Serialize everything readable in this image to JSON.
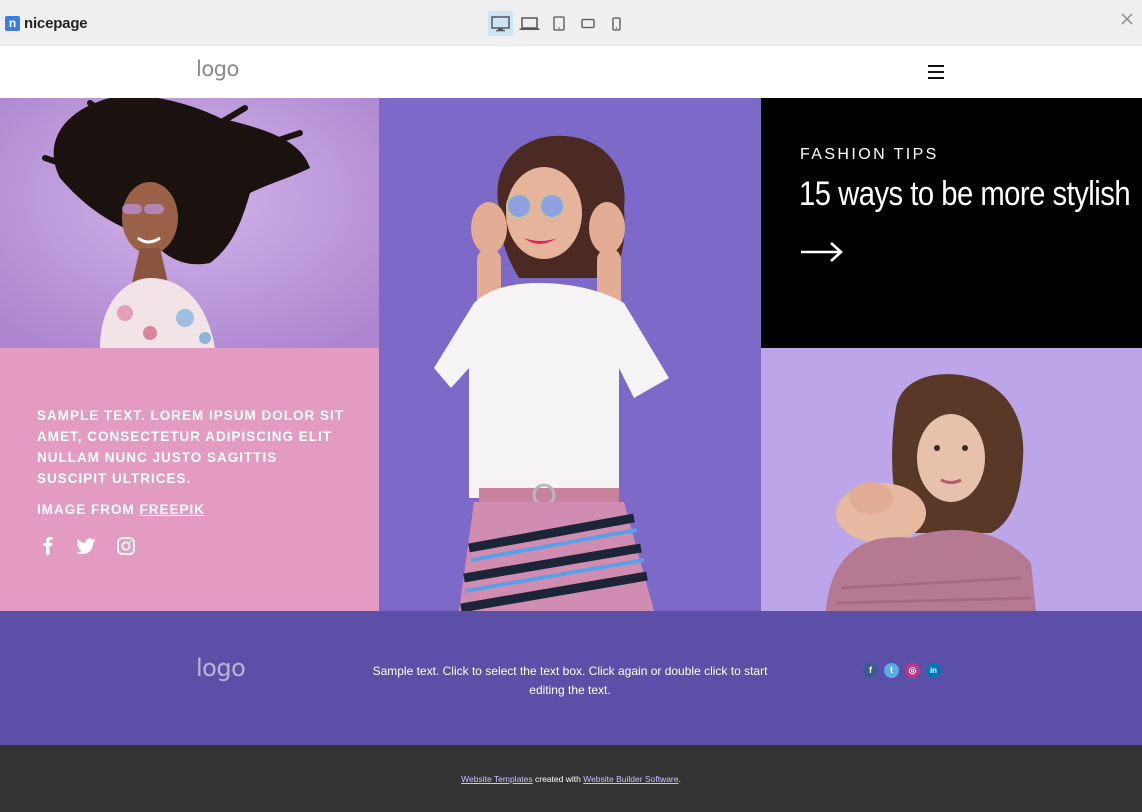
{
  "app": {
    "brand_mark": "n",
    "brand_name": "nicepage"
  },
  "toolbar": {
    "devices": [
      {
        "name": "desktop",
        "active": true
      },
      {
        "name": "laptop",
        "active": false
      },
      {
        "name": "tablet",
        "active": false
      },
      {
        "name": "tablet-landscape",
        "active": false
      },
      {
        "name": "phone",
        "active": false
      }
    ]
  },
  "header": {
    "logo": "logo"
  },
  "feature": {
    "kicker": "FASHION TIPS",
    "headline": "15 ways to be more stylish"
  },
  "info": {
    "sample_text": "SAMPLE TEXT. LOREM IPSUM DOLOR SIT AMET, CONSECTETUR ADIPISCING ELIT NULLAM NUNC JUSTO SAGITTIS SUSCIPIT ULTRICES.",
    "credit_prefix": "IMAGE FROM ",
    "credit_link": "FREEPIK"
  },
  "footer": {
    "logo": "logo",
    "text": "Sample text. Click to select the text box. Click again or double click to start editing the text.",
    "social": [
      {
        "name": "facebook",
        "glyph": "f",
        "color": "#3b5998"
      },
      {
        "name": "twitter",
        "glyph": "t",
        "color": "#55acee"
      },
      {
        "name": "instagram",
        "glyph": "◎",
        "color": "#c13584"
      },
      {
        "name": "linkedin",
        "glyph": "in",
        "color": "#0077b5"
      }
    ]
  },
  "bottom": {
    "link1": "Website Templates",
    "middle": " created with ",
    "link2": "Website Builder Software",
    "end": "."
  },
  "colors": {
    "accent": "#3b7de0",
    "info_pink": "#e39bc2",
    "footer_purple": "#5b4fa8",
    "bottom_dark": "#333333"
  }
}
